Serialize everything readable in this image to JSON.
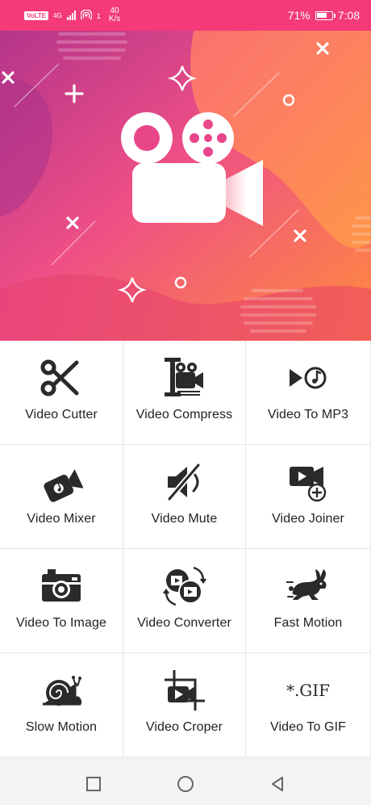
{
  "status_bar": {
    "volte": "VoLTE",
    "network": "4G",
    "data_count": "1",
    "speed_value": "40",
    "speed_unit": "K/s",
    "battery_percent": "71%",
    "battery_level": 0.71,
    "time": "7:08"
  },
  "colors": {
    "accent": "#f43a78",
    "icon": "#2a2a2a",
    "banner_from": "#c2357f",
    "banner_to": "#ff8a3c"
  },
  "banner": {
    "logo_icon": "video-camera-icon"
  },
  "tools": [
    {
      "label": "Video Cutter",
      "icon": "scissors-icon"
    },
    {
      "label": "Video Compress",
      "icon": "compress-clamp-icon"
    },
    {
      "label": "Video To MP3",
      "icon": "play-music-icon"
    },
    {
      "label": "Video Mixer",
      "icon": "music-camera-icon"
    },
    {
      "label": "Video Mute",
      "icon": "mute-speaker-icon"
    },
    {
      "label": "Video Joiner",
      "icon": "video-add-icon"
    },
    {
      "label": "Video To Image",
      "icon": "photo-camera-icon"
    },
    {
      "label": "Video Converter",
      "icon": "convert-film-icon"
    },
    {
      "label": "Fast Motion",
      "icon": "rabbit-icon"
    },
    {
      "label": "Slow Motion",
      "icon": "snail-icon"
    },
    {
      "label": "Video Croper",
      "icon": "crop-video-icon"
    },
    {
      "label": "Video To GIF",
      "icon": "gif-icon",
      "glyph": "*.GIF"
    }
  ],
  "nav": [
    "square-recents-icon",
    "circle-home-icon",
    "triangle-back-icon"
  ]
}
